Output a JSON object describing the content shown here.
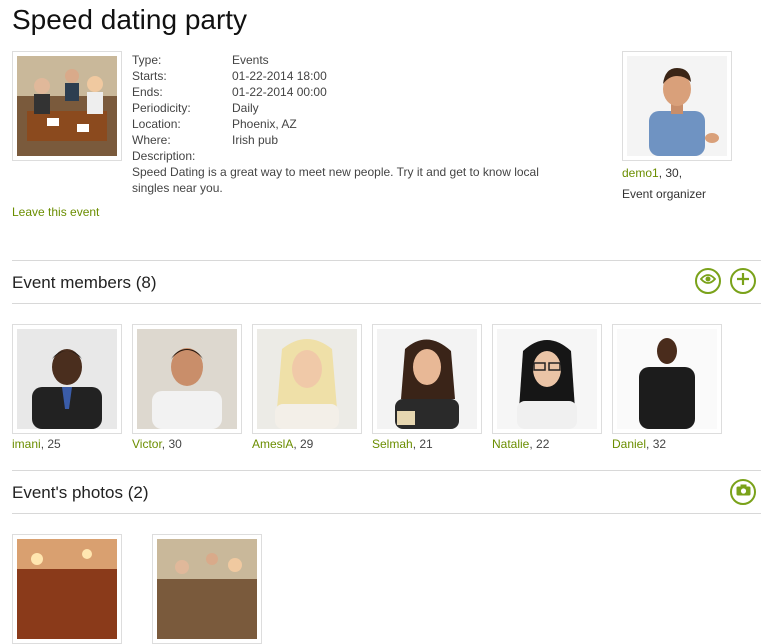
{
  "event": {
    "title": "Speed dating party",
    "details": [
      {
        "label": "Type:",
        "value": "Events"
      },
      {
        "label": "Starts:",
        "value": "01-22-2014 18:00"
      },
      {
        "label": "Ends:",
        "value": "01-22-2014 00:00"
      },
      {
        "label": "Periodicity:",
        "value": "Daily"
      },
      {
        "label": "Location:",
        "value": "Phoenix, AZ"
      },
      {
        "label": "Where:",
        "value": "Irish pub"
      },
      {
        "label": "Description:",
        "value": ""
      }
    ],
    "description": "Speed Dating is a great way to meet new people. Try it and get to know local singles near you.",
    "leave_link": "Leave this event"
  },
  "organizer": {
    "name": "demo1",
    "age_suffix": ", 30,",
    "role": "Event organizer"
  },
  "members_section": {
    "title": "Event members (8)",
    "view_icon": "eye-icon",
    "add_icon": "plus-icon"
  },
  "members": [
    {
      "name": "imani",
      "age": ", 25"
    },
    {
      "name": "Victor",
      "age": ", 30"
    },
    {
      "name": "AmeslA",
      "age": ", 29"
    },
    {
      "name": "Selmah",
      "age": ", 21"
    },
    {
      "name": "Natalie",
      "age": ", 22"
    },
    {
      "name": "Daniel",
      "age": ", 32"
    }
  ],
  "photos_section": {
    "title": "Event's photos (2)",
    "camera_icon": "camera-icon"
  },
  "colors": {
    "accent": "#6b8e00",
    "button_border": "#7aa21a"
  }
}
